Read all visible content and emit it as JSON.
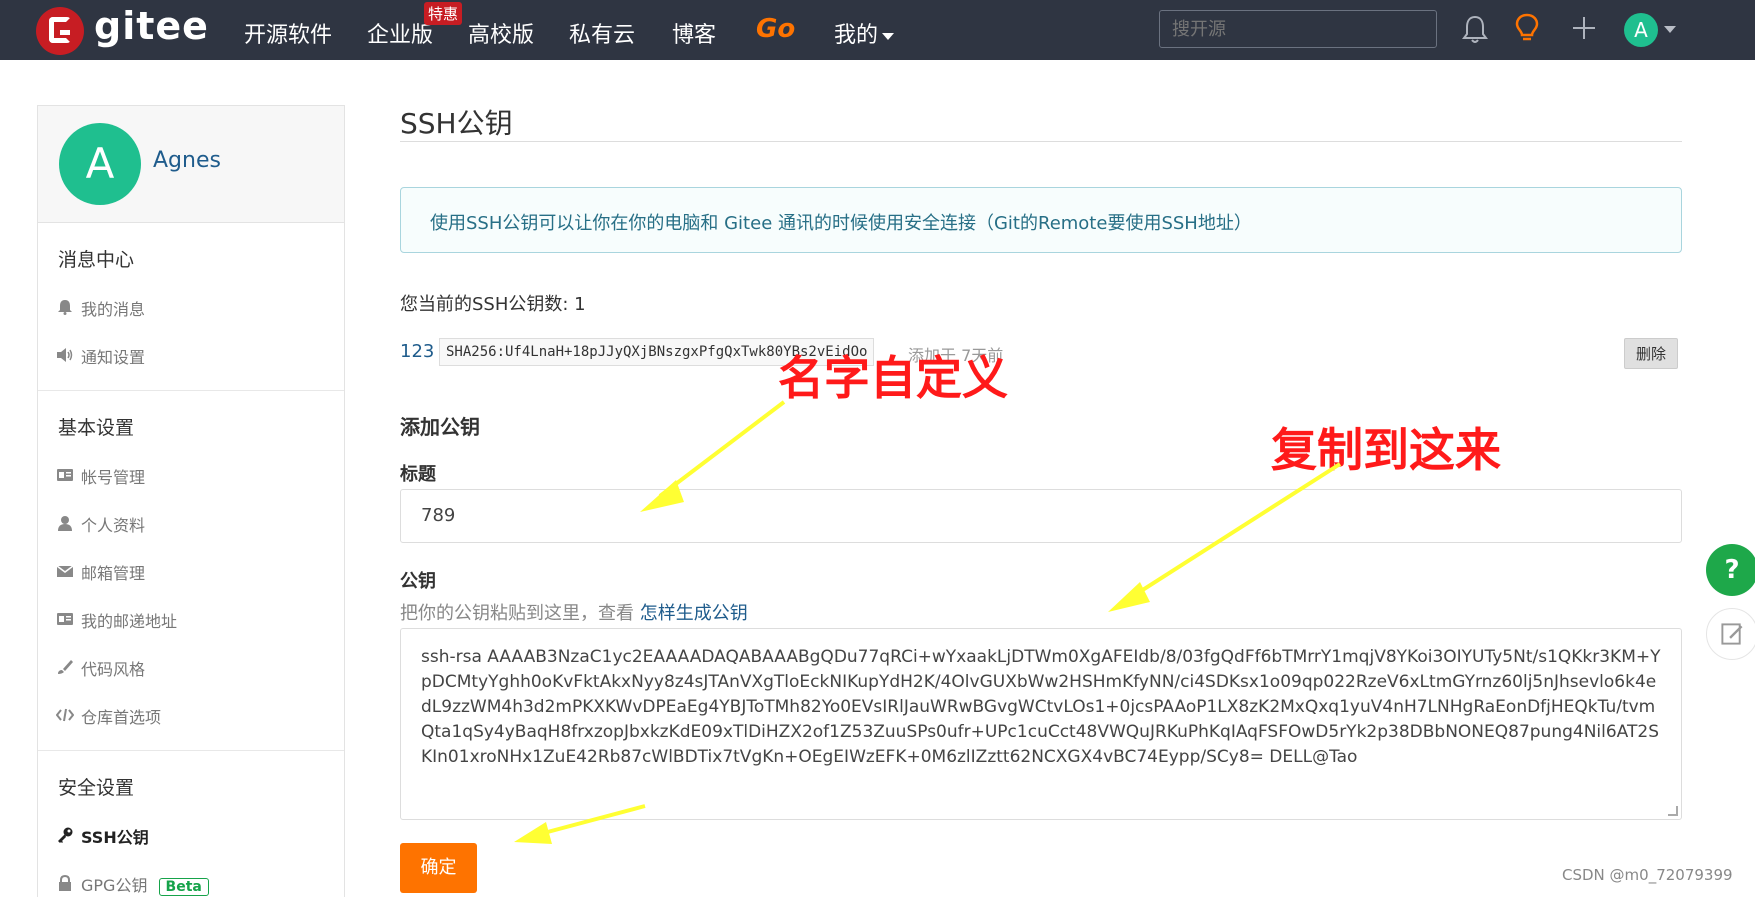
{
  "topbar": {
    "brand": "gitee",
    "nav": [
      "开源软件",
      "企业版",
      "高校版",
      "私有云",
      "博客",
      "Go",
      "我的"
    ],
    "badge": "特惠",
    "search_placeholder": "搜开源",
    "avatar_letter": "A"
  },
  "sidebar": {
    "user_name": "Agnes",
    "avatar_letter": "A",
    "sections": [
      {
        "title": "消息中心",
        "items": [
          "我的消息",
          "通知设置"
        ]
      },
      {
        "title": "基本设置",
        "items": [
          "帐号管理",
          "个人资料",
          "邮箱管理",
          "我的邮递地址",
          "代码风格",
          "仓库首选项"
        ]
      },
      {
        "title": "安全设置",
        "items": [
          "SSH公钥",
          "GPG公钥"
        ]
      }
    ],
    "beta": "Beta"
  },
  "main": {
    "title": "SSH公钥",
    "info": "使用SSH公钥可以让你在你的电脑和 Gitee 通讯的时候使用安全连接（Git的Remote要使用SSH地址）",
    "count_text": "您当前的SSH公钥数: 1",
    "key": {
      "name": "123",
      "fingerprint": "SHA256:Uf4LnaH+18pJJyQXjBNszgxPfgQxTwk80YBs2vEidOo",
      "date": "添加于 7天前",
      "delete_label": "删除"
    },
    "add_title": "添加公钥",
    "title_label": "标题",
    "title_value": "789",
    "pubkey_label": "公钥",
    "hint_text": "把你的公钥粘贴到这里，查看 ",
    "hint_link": "怎样生成公钥",
    "pubkey_value": "ssh-rsa AAAAB3NzaC1yc2EAAAADAQABAAABgQDu77qRCi+wYxaakLjDTWm0XgAFEIdb/8/03fgQdFf6bTMrrY1mqjV8YKoi3OIYUTy5Nt/s1QKkr3KM+YpDCMtyYghh0oKvFktAkxNyy8z4sJTAnVXgTloEckNIKupYdH2K/4OlvGUXbWw2HSHmKfyNN/ci4SDKsx1o09qp022RzeV6xLtmGYrnz60lj5nJhsevlo6k4edL9zzWM4h3d2mPKXKWvDPEaEg4YBJToTMh82Yo0EVsIRlJauWRwBGvgWCtvLOs1+0jcsPAAoP1LX8zK2MxQxq1yuV4nH7LNHgRaEonDfjHEQkTu/tvmQta1qSy4yBaqH8frxzopJbxkzKdE09xTlDiHZX2of1Z53ZuuSPs0ufr+UPc1cuCct48VWQuJRKuPhKqIAqFSFOwD5rYk2p38DBbNONEQ87pung4Nil6AT2SKIn01xroNHx1ZuE42Rb87cWlBDTix7tVgKn+OEgEIWzEFK+0M6zlIZztt62NCXGX4vBC74Eypp/SCy8= DELL@Tao",
    "submit_label": "确定"
  },
  "annotations": {
    "name_custom": "名字自定义",
    "copy_here": "复制到这来"
  },
  "float": {
    "help": "?"
  },
  "watermark": "CSDN @m0_72079399",
  "colors": {
    "topbar": "#2f3542",
    "brand_red": "#c71d23",
    "accent_orange": "#fe7300",
    "avatar_green": "#1fbf8f",
    "link_blue": "#1f5c8c",
    "annotation_red": "#ff1a1a",
    "arrow_yellow": "#ffff33"
  }
}
